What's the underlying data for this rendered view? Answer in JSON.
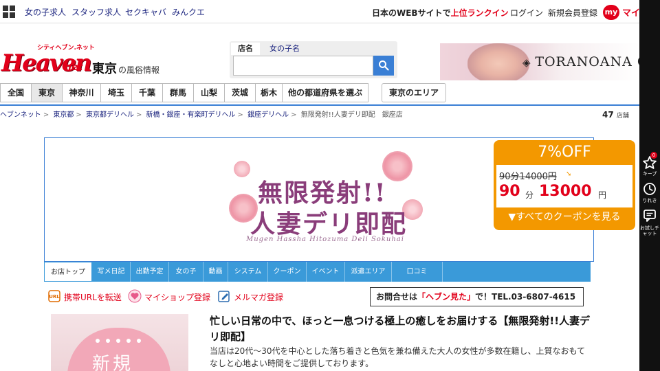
{
  "topbar": {
    "links": [
      "女の子求人",
      "スタッフ求人",
      "セクキャバ",
      "みんクエ"
    ],
    "rank_prefix": "日本のWEBサイトで",
    "rank_highlight": "上位ランクイン",
    "login": "ログイン",
    "register": "新規会員登録",
    "my_badge": "my",
    "my_text": "マイ"
  },
  "header": {
    "logo_small": "シティヘブン.ネット",
    "logo_main": "Heaven",
    "logo_net": "net",
    "region": "東京",
    "region_sub": "の風俗情報"
  },
  "search": {
    "tab_shop": "店名",
    "tab_girl": "女の子名",
    "placeholder": ""
  },
  "ad": {
    "text": "TORANOANA G"
  },
  "region_nav": {
    "items": [
      "全国",
      "東京",
      "神奈川",
      "埼玉",
      "千葉",
      "群馬",
      "山梨",
      "茨城",
      "栃木",
      "他の都道府県を選ぶ"
    ],
    "active": "東京",
    "area_button": "東京のエリア"
  },
  "breadcrumb": {
    "items": [
      "ヘブンネット",
      "東京都",
      "東京都デリヘル",
      "新橋・銀座・有楽町デリヘル",
      "銀座デリヘル"
    ],
    "current": "無限発射!!人妻デリ即配　銀座店",
    "count": "47",
    "count_unit": "店舗"
  },
  "shop": {
    "logo_line1": "無限発射!!",
    "logo_line2": "人妻デリ即配",
    "logo_roman": "Mugen Hassha Hitozuma Deli Sokuhai"
  },
  "coupon": {
    "title": "7%OFF",
    "old_price": "90分14000円",
    "minutes": "90",
    "minutes_unit": "分",
    "price": "13000",
    "price_unit": "円",
    "view_all": "▼すべてのクーポンを見る",
    "colors": {
      "bg": "#f39800",
      "price": "#e2001a"
    }
  },
  "shop_nav": {
    "items": [
      "お店トップ",
      "写メ日記",
      "出勤予定",
      "女の子",
      "動画",
      "システム",
      "クーポン",
      "イベント",
      "派遣エリア",
      "口コミ"
    ],
    "active": "お店トップ"
  },
  "actions": {
    "url_transfer": "携帯URLを転送",
    "myshop": "マイショップ登録",
    "mailmag": "メルマガ登録",
    "contact_prefix": "お問合せは",
    "contact_highlight": "「ヘブン見た」",
    "contact_suffix": "で！TEL.03-6807-4615"
  },
  "photo": {
    "label": "新規"
  },
  "description": {
    "title": "忙しい日常の中で、ほっと一息つける極上の癒しをお届けする【無限発射!!人妻デリ即配】",
    "body": "当店は20代～30代を中心とした落ち着きと色気を兼ね備えた大人の女性が多数在籍し、上質なおもてなしと心地よい時間をご提供しております。"
  },
  "sidebar": {
    "keep_label": "キープ",
    "keep_count": "0",
    "history_label": "りれき",
    "chat_label": "お試しチャット"
  }
}
